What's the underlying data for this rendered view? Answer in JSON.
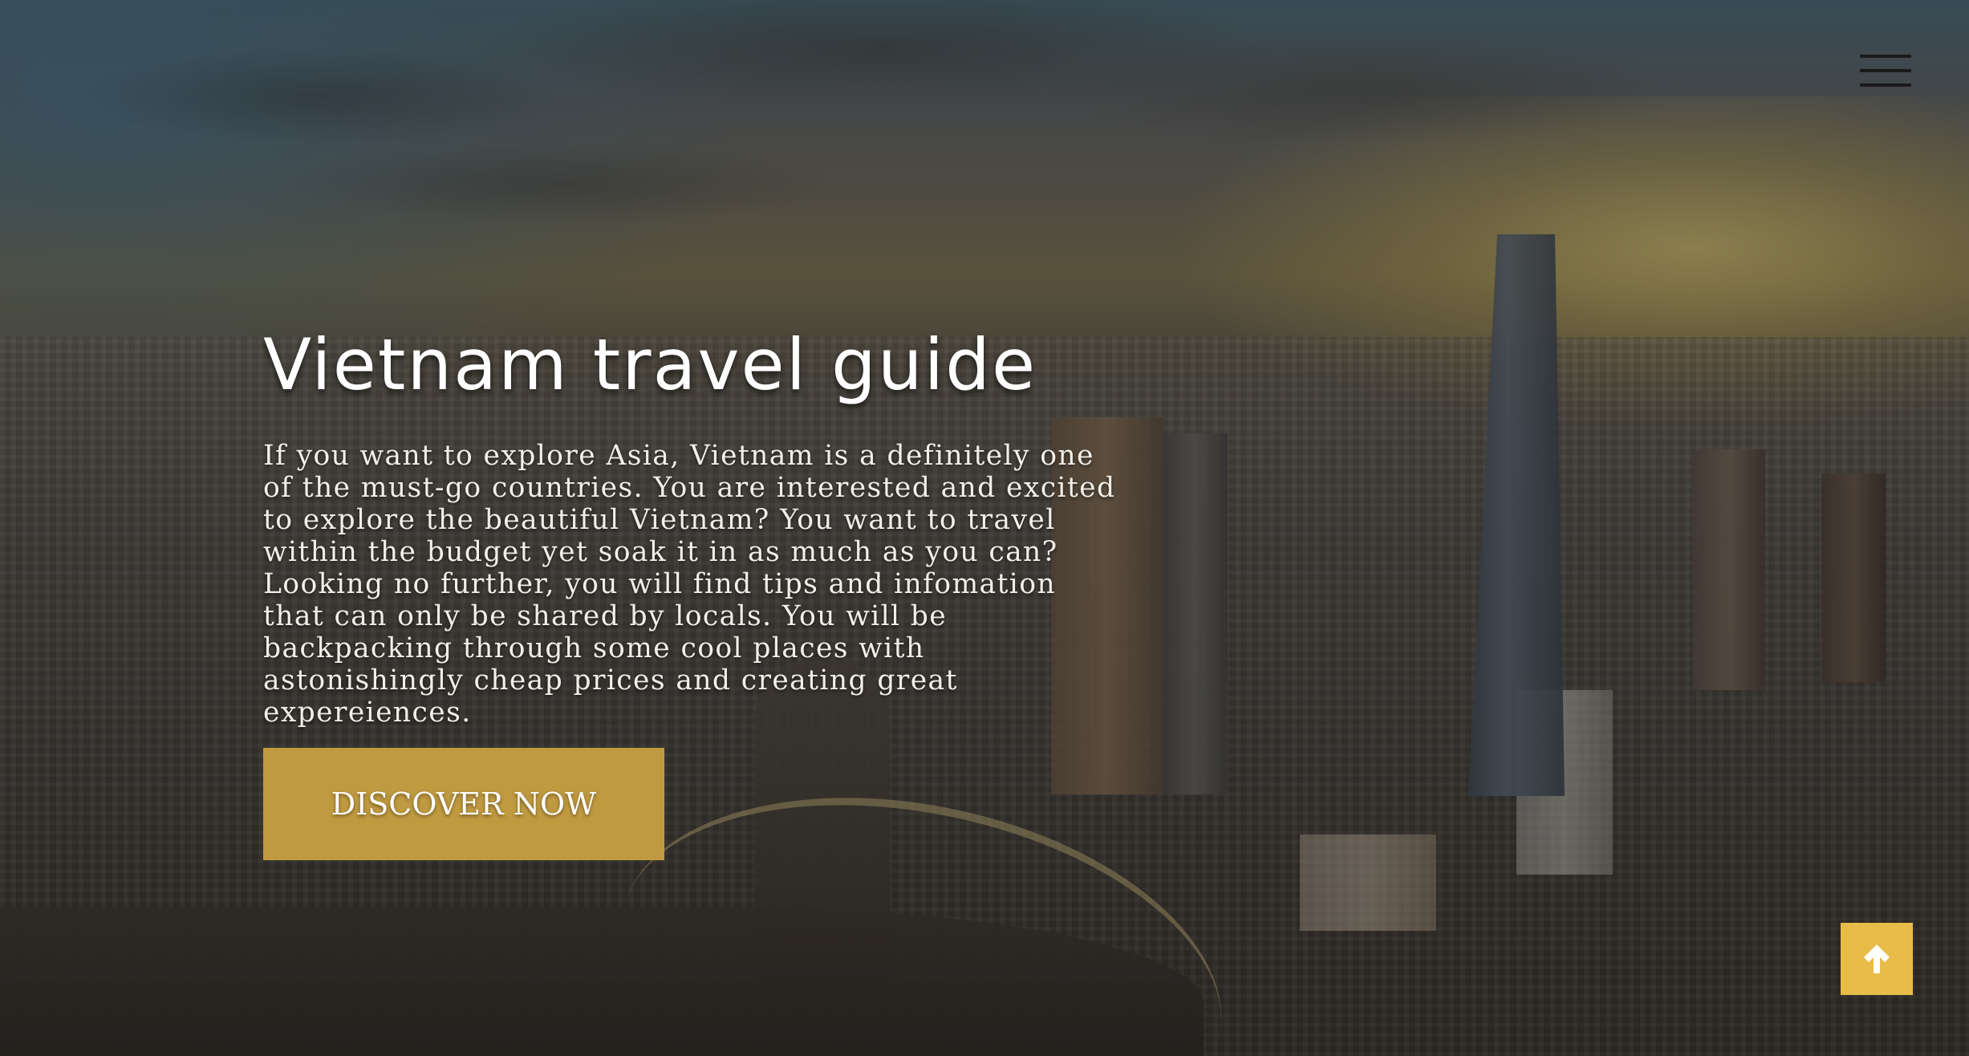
{
  "hero": {
    "title": "Vietnam travel guide",
    "description": "If you want to explore Asia, Vietnam is a definitely one of the must-go countries. You are interested and excited to explore the beautiful Vietnam? You want to travel within the budget yet soak it in as much as you can? Looking no further, you will find tips and infomation that can only be shared by locals. You will be backpacking through some cool places with astonishingly cheap prices and creating great expereiences.",
    "cta_label": "DISCOVER NOW"
  },
  "icons": {
    "menu": "hamburger-menu-icon",
    "scroll_top": "arrow-up-icon"
  },
  "colors": {
    "cta_background": "#c09a40",
    "scroll_top_background": "#e8bc48",
    "title_text": "#ffffff",
    "menu_icon": "#1a1a1a"
  }
}
